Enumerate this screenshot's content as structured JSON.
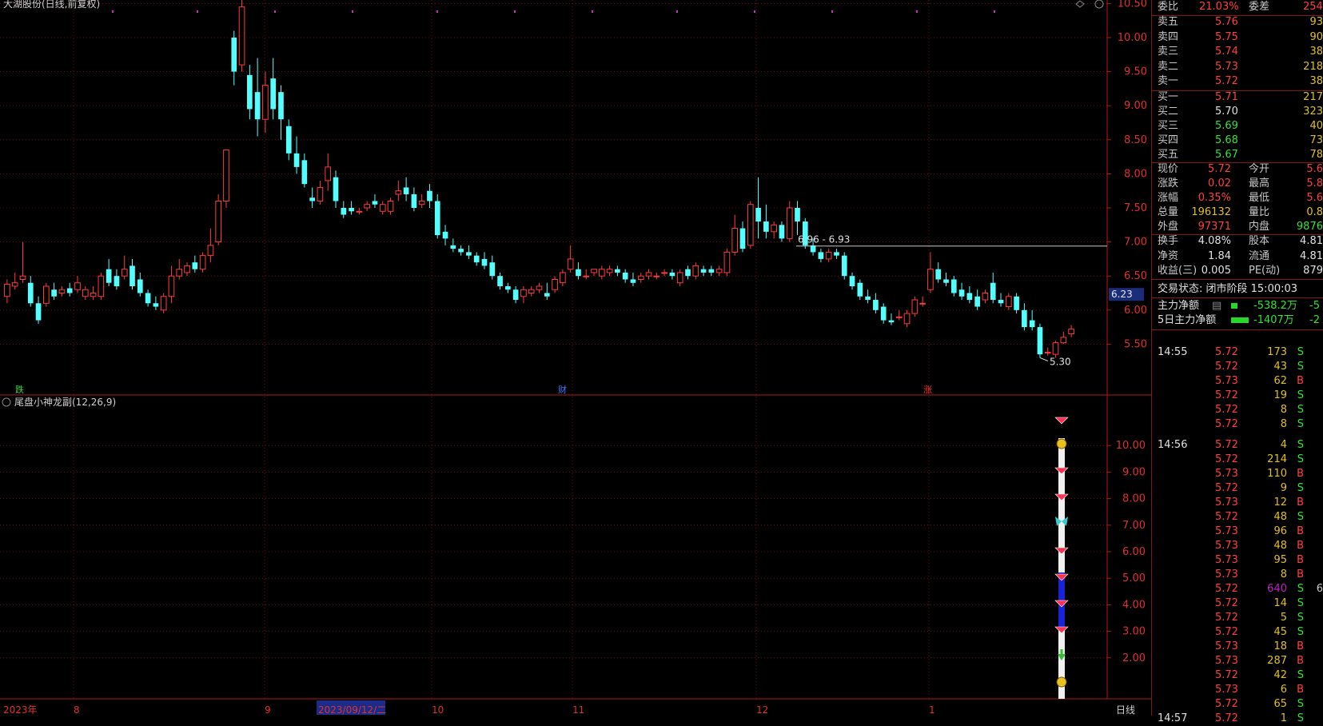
{
  "chart": {
    "title": "大湖股份(日线,前复权)",
    "high_label": "10.64",
    "low_label": "5.30",
    "current_price_tag": "6.23",
    "range_label": "6.96 - 6.93",
    "price_axis": [
      "10.50",
      "10.00",
      "9.50",
      "9.00",
      "8.50",
      "8.00",
      "7.50",
      "7.00",
      "6.50",
      "6.00",
      "5.50"
    ],
    "markers": [
      {
        "text": "跌",
        "color": "#38d040"
      },
      {
        "text": "财",
        "color": "#3c78ff"
      },
      {
        "text": "涨",
        "color": "#ff3030"
      }
    ],
    "indicator_title": "尾盘小神龙副(12,26,9)",
    "indicator_axis": [
      "10.00",
      "9.00",
      "8.00",
      "7.00",
      "6.00",
      "5.00",
      "4.00",
      "3.00",
      "2.00"
    ],
    "date_axis": [
      "2023年",
      "8",
      "9",
      "2023/09/12/二",
      "10",
      "11",
      "12",
      "1"
    ],
    "period_label": "日线",
    "candles": [
      [
        6.2,
        6.45,
        6.38,
        6.1
      ],
      [
        6.35,
        6.55,
        6.4,
        6.3
      ],
      [
        6.45,
        7.0,
        6.5,
        6.4
      ],
      [
        6.4,
        6.5,
        6.1,
        6.05
      ],
      [
        6.1,
        6.2,
        5.85,
        5.8
      ],
      [
        6.1,
        6.4,
        6.35,
        6.05
      ],
      [
        6.3,
        6.4,
        6.2,
        6.15
      ],
      [
        6.25,
        6.35,
        6.3,
        6.2
      ],
      [
        6.32,
        6.4,
        6.25,
        6.2
      ],
      [
        6.3,
        6.5,
        6.4,
        6.25
      ],
      [
        6.2,
        6.35,
        6.3,
        6.15
      ],
      [
        6.2,
        6.35,
        6.25,
        6.15
      ],
      [
        6.2,
        6.55,
        6.5,
        6.15
      ],
      [
        6.6,
        6.75,
        6.4,
        6.35
      ],
      [
        6.5,
        6.6,
        6.35,
        6.3
      ],
      [
        6.5,
        6.8,
        6.6,
        6.45
      ],
      [
        6.65,
        6.75,
        6.35,
        6.3
      ],
      [
        6.45,
        6.55,
        6.25,
        6.2
      ],
      [
        6.25,
        6.3,
        6.1,
        6.05
      ],
      [
        6.1,
        6.2,
        6.05,
        6.0
      ],
      [
        6.0,
        6.25,
        6.2,
        5.95
      ],
      [
        6.2,
        6.65,
        6.5,
        6.1
      ],
      [
        6.5,
        6.75,
        6.6,
        6.45
      ],
      [
        6.55,
        6.7,
        6.65,
        6.5
      ],
      [
        6.7,
        6.8,
        6.6,
        6.55
      ],
      [
        6.6,
        6.85,
        6.8,
        6.55
      ],
      [
        6.8,
        7.2,
        6.95,
        6.7
      ],
      [
        7.0,
        7.7,
        7.6,
        6.95
      ],
      [
        7.6,
        8.35,
        8.35,
        7.5
      ],
      [
        10.0,
        10.1,
        9.5,
        9.3
      ],
      [
        9.6,
        10.64,
        10.45,
        9.5
      ],
      [
        9.45,
        9.6,
        8.95,
        8.8
      ],
      [
        9.2,
        9.7,
        8.8,
        8.55
      ],
      [
        8.8,
        9.5,
        9.3,
        8.6
      ],
      [
        9.4,
        9.7,
        8.95,
        8.8
      ],
      [
        9.2,
        9.3,
        8.8,
        8.5
      ],
      [
        8.7,
        8.8,
        8.3,
        8.2
      ],
      [
        8.3,
        8.55,
        8.1,
        8.0
      ],
      [
        8.2,
        8.3,
        7.85,
        7.8
      ],
      [
        7.65,
        7.8,
        7.6,
        7.5
      ],
      [
        7.6,
        7.9,
        7.8,
        7.55
      ],
      [
        7.9,
        8.3,
        8.1,
        7.75
      ],
      [
        7.95,
        8.05,
        7.6,
        7.5
      ],
      [
        7.5,
        7.6,
        7.4,
        7.35
      ],
      [
        7.5,
        7.6,
        7.45,
        7.4
      ],
      [
        7.45,
        7.5,
        7.45,
        7.4
      ],
      [
        7.5,
        7.6,
        7.55,
        7.45
      ],
      [
        7.6,
        7.7,
        7.55,
        7.5
      ],
      [
        7.45,
        7.6,
        7.55,
        7.4
      ],
      [
        7.45,
        7.65,
        7.6,
        7.4
      ],
      [
        7.7,
        7.9,
        7.75,
        7.6
      ],
      [
        7.8,
        7.95,
        7.7,
        7.6
      ],
      [
        7.7,
        7.8,
        7.5,
        7.45
      ],
      [
        7.55,
        7.7,
        7.6,
        7.5
      ],
      [
        7.75,
        7.85,
        7.6,
        7.5
      ],
      [
        7.6,
        7.7,
        7.1,
        7.05
      ],
      [
        7.15,
        7.25,
        7.05,
        6.95
      ],
      [
        6.95,
        7.05,
        6.9,
        6.85
      ],
      [
        6.9,
        6.95,
        6.85,
        6.8
      ],
      [
        6.85,
        6.95,
        6.8,
        6.75
      ],
      [
        6.8,
        6.85,
        6.7,
        6.65
      ],
      [
        6.75,
        6.85,
        6.65,
        6.6
      ],
      [
        6.7,
        6.8,
        6.5,
        6.45
      ],
      [
        6.5,
        6.55,
        6.35,
        6.3
      ],
      [
        6.35,
        6.4,
        6.3,
        6.25
      ],
      [
        6.3,
        6.35,
        6.15,
        6.1
      ],
      [
        6.2,
        6.35,
        6.3,
        6.1
      ],
      [
        6.25,
        6.35,
        6.3,
        6.2
      ],
      [
        6.3,
        6.4,
        6.35,
        6.25
      ],
      [
        6.25,
        6.4,
        6.2,
        6.15
      ],
      [
        6.3,
        6.5,
        6.45,
        6.25
      ],
      [
        6.4,
        6.6,
        6.55,
        6.35
      ],
      [
        6.6,
        6.95,
        6.75,
        6.55
      ],
      [
        6.6,
        6.7,
        6.5,
        6.45
      ],
      [
        6.5,
        6.6,
        6.5,
        6.45
      ],
      [
        6.55,
        6.6,
        6.6,
        6.5
      ],
      [
        6.5,
        6.65,
        6.6,
        6.45
      ],
      [
        6.55,
        6.65,
        6.6,
        6.5
      ],
      [
        6.6,
        6.65,
        6.55,
        6.5
      ],
      [
        6.55,
        6.6,
        6.45,
        6.4
      ],
      [
        6.45,
        6.55,
        6.4,
        6.35
      ],
      [
        6.45,
        6.55,
        6.5,
        6.4
      ],
      [
        6.5,
        6.6,
        6.55,
        6.45
      ],
      [
        6.5,
        6.55,
        6.5,
        6.45
      ],
      [
        6.55,
        6.6,
        6.55,
        6.5
      ],
      [
        6.55,
        6.6,
        6.5,
        6.45
      ],
      [
        6.4,
        6.6,
        6.55,
        6.35
      ],
      [
        6.6,
        6.65,
        6.5,
        6.45
      ],
      [
        6.5,
        6.7,
        6.65,
        6.45
      ],
      [
        6.6,
        6.65,
        6.55,
        6.5
      ],
      [
        6.6,
        6.65,
        6.55,
        6.5
      ],
      [
        6.55,
        6.65,
        6.6,
        6.5
      ],
      [
        6.55,
        6.9,
        6.85,
        6.5
      ],
      [
        6.85,
        7.4,
        7.2,
        6.8
      ],
      [
        7.2,
        7.3,
        6.9,
        6.85
      ],
      [
        6.95,
        7.6,
        7.55,
        6.9
      ],
      [
        7.5,
        7.95,
        7.3,
        7.05
      ],
      [
        7.3,
        7.55,
        7.15,
        7.05
      ],
      [
        7.15,
        7.3,
        7.25,
        7.05
      ],
      [
        7.25,
        7.3,
        7.05,
        7.0
      ],
      [
        7.05,
        7.6,
        7.5,
        7.0
      ],
      [
        7.5,
        7.6,
        7.3,
        7.1
      ],
      [
        7.3,
        7.35,
        6.95,
        6.9
      ],
      [
        6.95,
        7.05,
        6.85,
        6.8
      ],
      [
        6.85,
        6.9,
        6.75,
        6.7
      ],
      [
        6.75,
        6.9,
        6.85,
        6.7
      ],
      [
        6.85,
        6.9,
        6.8,
        6.75
      ],
      [
        6.8,
        6.85,
        6.5,
        6.45
      ],
      [
        6.5,
        6.55,
        6.35,
        6.3
      ],
      [
        6.4,
        6.45,
        6.2,
        6.15
      ],
      [
        6.2,
        6.3,
        6.15,
        6.1
      ],
      [
        6.15,
        6.25,
        6.0,
        5.95
      ],
      [
        6.05,
        6.1,
        5.85,
        5.8
      ],
      [
        5.85,
        5.95,
        5.82,
        5.78
      ],
      [
        5.9,
        6.0,
        5.9,
        5.85
      ],
      [
        5.8,
        6.0,
        5.95,
        5.75
      ],
      [
        5.95,
        6.2,
        6.15,
        5.9
      ],
      [
        6.1,
        6.2,
        6.1,
        6.05
      ],
      [
        6.3,
        6.85,
        6.6,
        6.25
      ],
      [
        6.6,
        6.7,
        6.45,
        6.4
      ],
      [
        6.45,
        6.55,
        6.4,
        6.35
      ],
      [
        6.45,
        6.5,
        6.25,
        6.2
      ],
      [
        6.3,
        6.4,
        6.2,
        6.15
      ],
      [
        6.25,
        6.35,
        6.15,
        6.1
      ],
      [
        6.2,
        6.3,
        6.05,
        6.0
      ],
      [
        6.15,
        6.3,
        6.25,
        6.1
      ],
      [
        6.4,
        6.55,
        6.15,
        6.1
      ],
      [
        6.15,
        6.25,
        6.1,
        6.05
      ],
      [
        6.05,
        6.25,
        6.2,
        6.0
      ],
      [
        6.2,
        6.25,
        6.0,
        5.95
      ],
      [
        6.0,
        6.1,
        5.75,
        5.7
      ],
      [
        5.85,
        6.0,
        5.75,
        5.7
      ],
      [
        5.75,
        5.8,
        5.35,
        5.3
      ],
      [
        5.38,
        5.45,
        5.38,
        5.33
      ],
      [
        5.35,
        5.55,
        5.52,
        5.3
      ],
      [
        5.52,
        5.68,
        5.6,
        5.5
      ],
      [
        5.65,
        5.78,
        5.72,
        5.6
      ]
    ]
  },
  "indicator_icons": [
    "gem",
    "coin",
    "gem",
    "gem",
    "butterfly",
    "gem",
    "gem",
    "gem",
    "gem",
    "arrow",
    "coin"
  ],
  "panel": {
    "ratio": {
      "label": "委比",
      "value": "21.03%",
      "diff_label": "委差",
      "diff_value": "254"
    },
    "asks": [
      {
        "label": "卖五",
        "price": "5.76",
        "vol": "93"
      },
      {
        "label": "卖四",
        "price": "5.75",
        "vol": "90"
      },
      {
        "label": "卖三",
        "price": "5.74",
        "vol": "38"
      },
      {
        "label": "卖二",
        "price": "5.73",
        "vol": "218"
      },
      {
        "label": "卖一",
        "price": "5.72",
        "vol": "38"
      }
    ],
    "bids": [
      {
        "label": "买一",
        "price": "5.71",
        "vol": "217"
      },
      {
        "label": "买二",
        "price": "5.70",
        "vol": "323"
      },
      {
        "label": "买三",
        "price": "5.69",
        "vol": "40"
      },
      {
        "label": "买四",
        "price": "5.68",
        "vol": "73"
      },
      {
        "label": "买五",
        "price": "5.67",
        "vol": "78"
      }
    ],
    "stats": [
      {
        "l1": "现价",
        "v1": "5.72",
        "l2": "今开",
        "v2": "5.6"
      },
      {
        "l1": "涨跌",
        "v1": "0.02",
        "l2": "最高",
        "v2": "5.8"
      },
      {
        "l1": "涨幅",
        "v1": "0.35%",
        "l2": "最低",
        "v2": "5.6"
      },
      {
        "l1": "总量",
        "v1": "196132",
        "l2": "量比",
        "v2": "0.8"
      },
      {
        "l1": "外盘",
        "v1": "97371",
        "l2": "内盘",
        "v2": "9876"
      }
    ],
    "stats2": [
      {
        "l1": "换手",
        "v1": "4.08%",
        "l2": "股本",
        "v2": "4.81"
      },
      {
        "l1": "净资",
        "v1": "1.84",
        "l2": "流通",
        "v2": "4.81"
      },
      {
        "l1": "收益(三)",
        "v1": "0.005",
        "l2": "PE(动)",
        "v2": "879"
      }
    ],
    "trade_status": "交易状态: 闭市阶段 15:00:03",
    "main_flow": {
      "label": "主力净额",
      "value": "-538.2万",
      "pct": "-5"
    },
    "main_flow5": {
      "label": "5日主力净额",
      "value": "-1407万",
      "pct": "-2"
    },
    "ticks": [
      {
        "t": "14:55",
        "p": "5.72",
        "v": "173",
        "s": "S"
      },
      {
        "t": "",
        "p": "5.72",
        "v": "43",
        "s": "S"
      },
      {
        "t": "",
        "p": "5.73",
        "v": "62",
        "s": "B"
      },
      {
        "t": "",
        "p": "5.72",
        "v": "19",
        "s": "S"
      },
      {
        "t": "",
        "p": "5.72",
        "v": "8",
        "s": "S"
      },
      {
        "t": "",
        "p": "5.72",
        "v": "8",
        "s": "S"
      },
      {
        "t": "14:56",
        "p": "5.72",
        "v": "4",
        "s": "S"
      },
      {
        "t": "",
        "p": "5.72",
        "v": "214",
        "s": "S"
      },
      {
        "t": "",
        "p": "5.73",
        "v": "110",
        "s": "B"
      },
      {
        "t": "",
        "p": "5.72",
        "v": "9",
        "s": "S"
      },
      {
        "t": "",
        "p": "5.73",
        "v": "12",
        "s": "B"
      },
      {
        "t": "",
        "p": "5.72",
        "v": "48",
        "s": "S"
      },
      {
        "t": "",
        "p": "5.73",
        "v": "96",
        "s": "B"
      },
      {
        "t": "",
        "p": "5.73",
        "v": "48",
        "s": "B"
      },
      {
        "t": "",
        "p": "5.73",
        "v": "95",
        "s": "B"
      },
      {
        "t": "",
        "p": "5.73",
        "v": "8",
        "s": "B"
      },
      {
        "t": "",
        "p": "5.72",
        "v": "640",
        "s": "S",
        "x": "6"
      },
      {
        "t": "",
        "p": "5.72",
        "v": "14",
        "s": "S"
      },
      {
        "t": "",
        "p": "5.72",
        "v": "5",
        "s": "S"
      },
      {
        "t": "",
        "p": "5.72",
        "v": "45",
        "s": "S"
      },
      {
        "t": "",
        "p": "5.73",
        "v": "18",
        "s": "B"
      },
      {
        "t": "",
        "p": "5.73",
        "v": "287",
        "s": "B"
      },
      {
        "t": "",
        "p": "5.72",
        "v": "42",
        "s": "S"
      },
      {
        "t": "",
        "p": "5.73",
        "v": "6",
        "s": "B"
      },
      {
        "t": "",
        "p": "5.72",
        "v": "65",
        "s": "S"
      },
      {
        "t": "14:57",
        "p": "5.72",
        "v": "1",
        "s": "S"
      }
    ]
  }
}
